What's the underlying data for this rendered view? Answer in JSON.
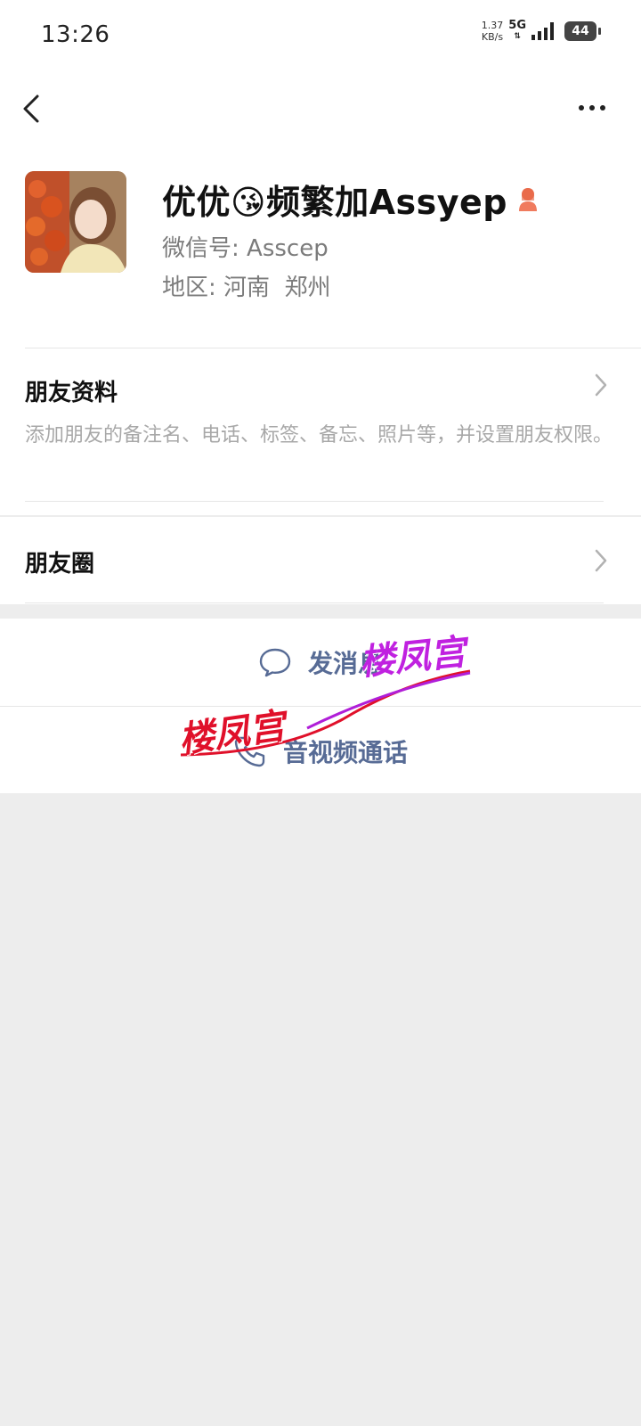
{
  "status_bar": {
    "time": "13:26",
    "net_speed_value": "1.37",
    "net_speed_unit": "KB/s",
    "network": "5G",
    "battery": "44"
  },
  "nav": {
    "back_icon": "chevron-left-icon",
    "more_icon": "more-dots-icon"
  },
  "profile": {
    "name": "优优😘频繁加Assyep",
    "wechat_id_label": "微信号:",
    "wechat_id": "Asscep",
    "region_label": "地区:",
    "region": "河南  郑州",
    "gender_icon": "female-icon"
  },
  "friend_info": {
    "title": "朋友资料",
    "description": "添加朋友的备注名、电话、标签、备忘、照片等，并设置朋友权限。"
  },
  "moments": {
    "title": "朋友圈"
  },
  "actions": {
    "send_message": "发消息",
    "call": "音视频通话",
    "link_color": "#576b95"
  },
  "watermark": {
    "text_1": "楼凤宫",
    "text_2": "楼凤宫"
  }
}
